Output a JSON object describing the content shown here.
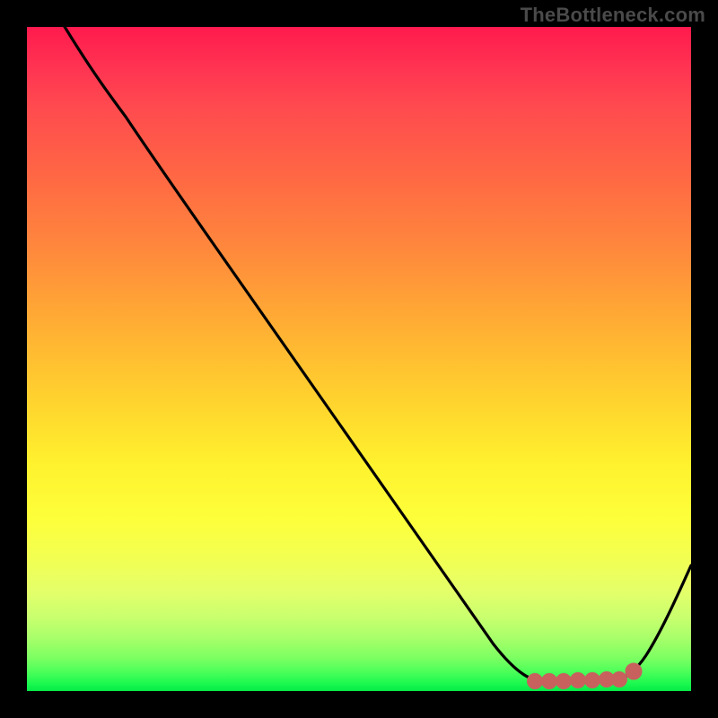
{
  "watermark": "TheBottleneck.com",
  "chart_data": {
    "type": "line",
    "title": "",
    "xlabel": "",
    "ylabel": "",
    "xlim": [
      0,
      100
    ],
    "ylim": [
      0,
      100
    ],
    "x": [
      5,
      10,
      15,
      20,
      25,
      30,
      35,
      40,
      45,
      50,
      55,
      60,
      65,
      70,
      75,
      80,
      85,
      90,
      95,
      100
    ],
    "values": [
      100,
      96,
      91,
      85,
      79,
      72,
      65.5,
      59,
      52,
      45,
      38,
      31,
      24,
      16.5,
      9,
      3.2,
      1.5,
      1.8,
      7,
      18
    ],
    "flat_region_x": [
      78,
      90
    ],
    "flat_region_y": 1.6,
    "flat_marker_color": "#c8605e",
    "curve_color": "#000000",
    "gradient_stops": [
      {
        "pos": 0,
        "color": "#ff1a4d"
      },
      {
        "pos": 50,
        "color": "#ffd530"
      },
      {
        "pos": 80,
        "color": "#f6ff48"
      },
      {
        "pos": 100,
        "color": "#08e846"
      }
    ]
  }
}
